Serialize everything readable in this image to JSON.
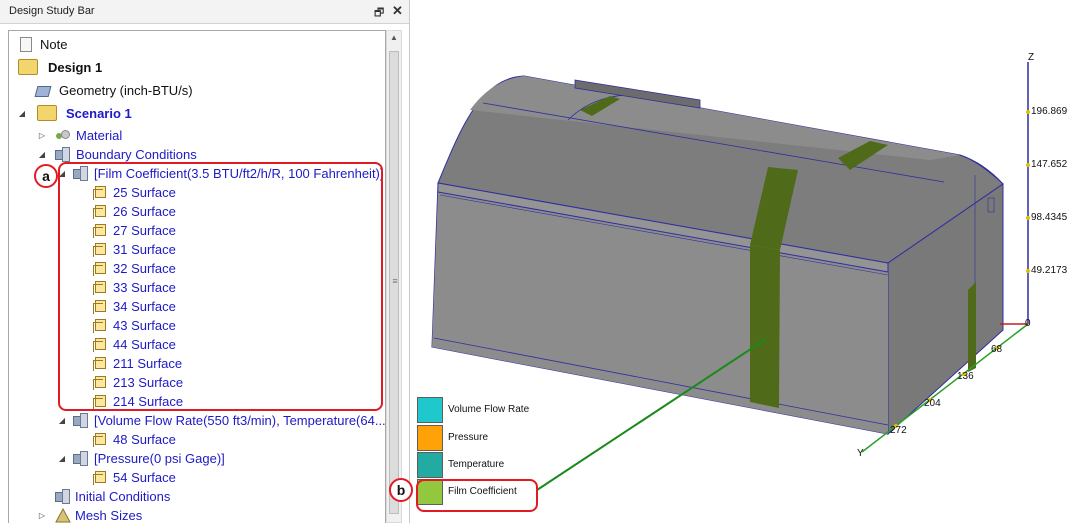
{
  "panel": {
    "title": "Design Study Bar",
    "pin_icon": "pin-icon",
    "close_icon": "close-icon",
    "close_glyph": "✕"
  },
  "tree": {
    "note": "Note",
    "design": "Design 1",
    "geometry": "Geometry (inch-BTU/s)",
    "scenario": "Scenario 1",
    "material": "Material",
    "boundary_conditions": "Boundary Conditions",
    "film_coefficient": "[Film Coefficient(3.5 BTU/ft2/h/R, 100 Fahrenheit)]",
    "film_surfaces": [
      "25 Surface",
      "26 Surface",
      "27 Surface",
      "31 Surface",
      "32 Surface",
      "33 Surface",
      "34 Surface",
      "43 Surface",
      "44 Surface",
      "211 Surface",
      "213 Surface",
      "214 Surface"
    ],
    "volume_flow": "[Volume Flow Rate(550 ft3/min), Temperature(64...",
    "volume_surfaces": [
      "48 Surface"
    ],
    "pressure": "[Pressure(0 psi Gage)]",
    "pressure_surfaces": [
      "54 Surface"
    ],
    "initial_conditions": "Initial Conditions",
    "mesh_sizes": "Mesh Sizes"
  },
  "callouts": {
    "a": "a",
    "b": "b"
  },
  "legend": [
    {
      "label": "Volume Flow Rate",
      "color": "#1ec8cd"
    },
    {
      "label": "Pressure",
      "color": "#ffa20a"
    },
    {
      "label": "Temperature",
      "color": "#22aaa3"
    },
    {
      "label": "Film Coefficient",
      "color": "#92c83e"
    }
  ],
  "axes": {
    "z_label": "Z",
    "y_label": "Y",
    "z_ticks": [
      "196.869",
      "147.652",
      "98.4345",
      "49.2173",
      "0"
    ],
    "y_ticks": [
      "68",
      "136",
      "204",
      "272"
    ]
  },
  "colors": {
    "callout_red": "#e01b24",
    "tree_blue": "#1d1ac4",
    "model_grey": "#8a8a8a",
    "band_green": "#4f6b1a"
  }
}
